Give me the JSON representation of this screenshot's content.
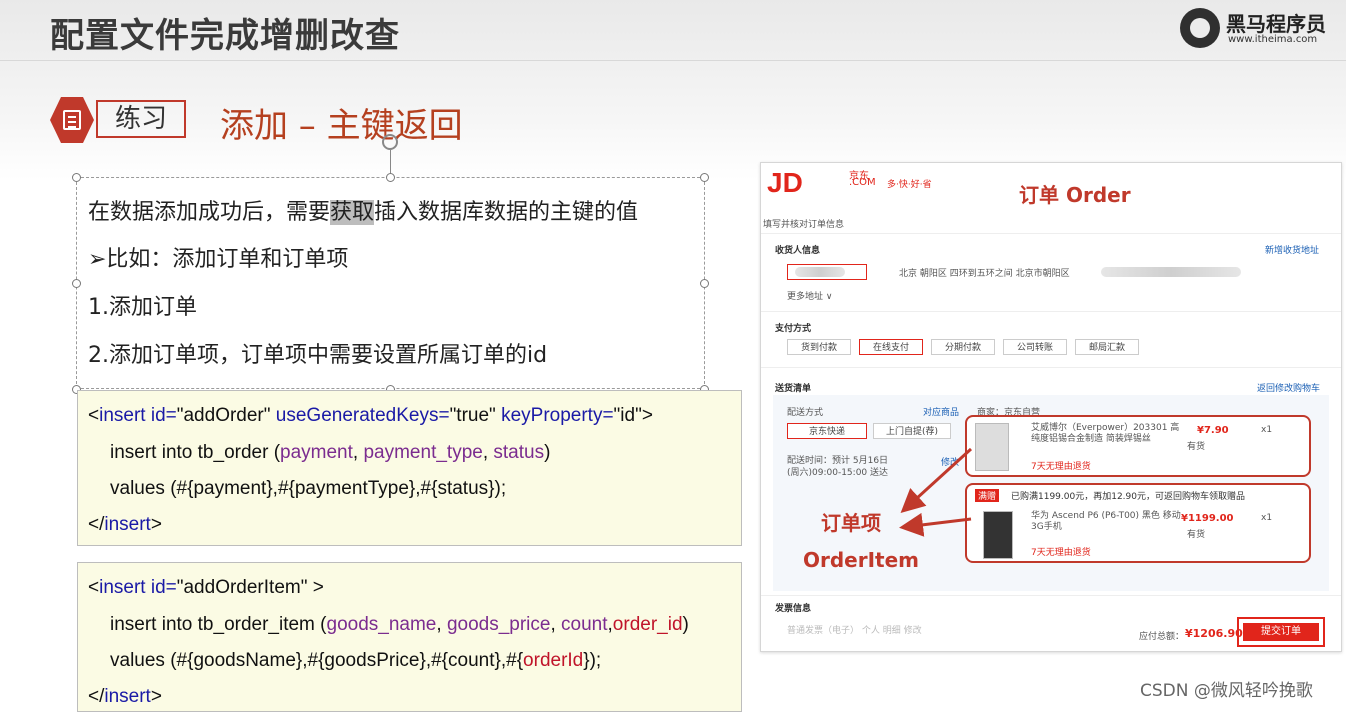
{
  "header": {
    "title": "配置文件完成增删改查",
    "logo_cn": "黑马程序员",
    "logo_url": "www.itheima.com"
  },
  "section": {
    "badge": "练习",
    "title": "添加 – 主键返回"
  },
  "text_box": {
    "line1_pre": "在数据添加成功后，需要",
    "line1_hl": "获取",
    "line1_post": "插入数据库数据的主键的值",
    "line2": "➢比如：添加订单和订单项",
    "line3": "1.添加订单",
    "line4": "2.添加订单项，订单项中需要设置所属订单的id"
  },
  "code1": {
    "l1_open": "<",
    "l1_tag": "insert",
    "l1_a1": " id=",
    "l1_v1": "\"addOrder\"",
    "l1_a2": " useGeneratedKeys=",
    "l1_v2": "\"true\"",
    "l1_a3": " keyProperty=",
    "l1_v3": "\"id\"",
    "l1_close": ">",
    "l2_pre": "insert into tb_order (",
    "l2_c1": "payment",
    "l2_s1": ", ",
    "l2_c2": "payment_type",
    "l2_s2": ", ",
    "l2_c3": "status",
    "l2_post": ")",
    "l3": "values (#{payment},#{paymentType},#{status});",
    "l4_open": "</",
    "l4_tag": "insert",
    "l4_close": ">"
  },
  "code2": {
    "l1_open": "<",
    "l1_tag": "insert",
    "l1_a1": " id=",
    "l1_v1": "\"addOrderItem\"",
    "l1_close": " >",
    "l2_pre": "insert into tb_order_item (",
    "l2_c1": "goods_name",
    "l2_s1": ", ",
    "l2_c2": "goods_price",
    "l2_s2": ", ",
    "l2_c3": "count",
    "l2_s3": ",",
    "l2_c4": "order_id",
    "l2_post": ")",
    "l3_pre": "values (#{goodsName},#{goodsPrice},#{count},#{",
    "l3_red": "orderId",
    "l3_post": "});",
    "l4_open": "</",
    "l4_tag": "insert",
    "l4_close": ">"
  },
  "jd": {
    "logo": "JD",
    "logo_cn": "京东",
    "logo_com": ".COM",
    "slogan": "多·快·好·省",
    "order_label": "订单 Order",
    "fill_info": "填写并核对订单信息",
    "receiver": "收货人信息",
    "new_address": "新增收货地址",
    "address": "北京 朝阳区 四环到五环之间 北京市朝阳区",
    "more_address": "更多地址 ∨",
    "payment_method": "支付方式",
    "pay_options": [
      "货到付款",
      "在线支付",
      "分期付款",
      "公司转账",
      "邮局汇款"
    ],
    "shipping_list": "送货清单",
    "back_to_cart": "返回修改购物车",
    "delivery_method": "配送方式",
    "matching_goods": "对应商品",
    "shipping_options": [
      "京东快递",
      "上门自提(荐)"
    ],
    "delivery_time": "配送时间：预计 5月16日(周六)09:00-15:00 送达",
    "modify": "修改",
    "merchant": "商家：京东自营",
    "item1_name": "艾威博尔（Everpower）203301 高纯度铝锡合金制造 简装焊锡丝",
    "item1_price": "¥7.90",
    "item1_qty": "x1",
    "item1_stock": "有货",
    "item1_return": "7天无理由退货",
    "promo_tag": "满赠",
    "promo_text": "已购满1199.00元，再加12.90元，可返回购物车领取赠品",
    "item2_name": "华为 Ascend P6 (P6-T00) 黑色 移动3G手机",
    "item2_price": "¥1199.00",
    "item2_qty": "x1",
    "item2_stock": "有货",
    "item2_return": "7天无理由退货",
    "order_item_cn": "订单项",
    "order_item_en": "OrderItem",
    "invoice": "发票信息",
    "invoice_options": "普通发票（电子）   个人   明细   修改",
    "total_label": "应付总额：",
    "total_value": "¥1206.90",
    "submit": "提交订单"
  },
  "watermark": "CSDN @微风轻吟挽歌",
  "colors": {
    "accent_red": "#c0392b",
    "jd_red": "#e1251b",
    "code_bg": "#fbfbe4",
    "code_blue": "#1a1aa6",
    "code_purple": "#7b2c8f"
  }
}
